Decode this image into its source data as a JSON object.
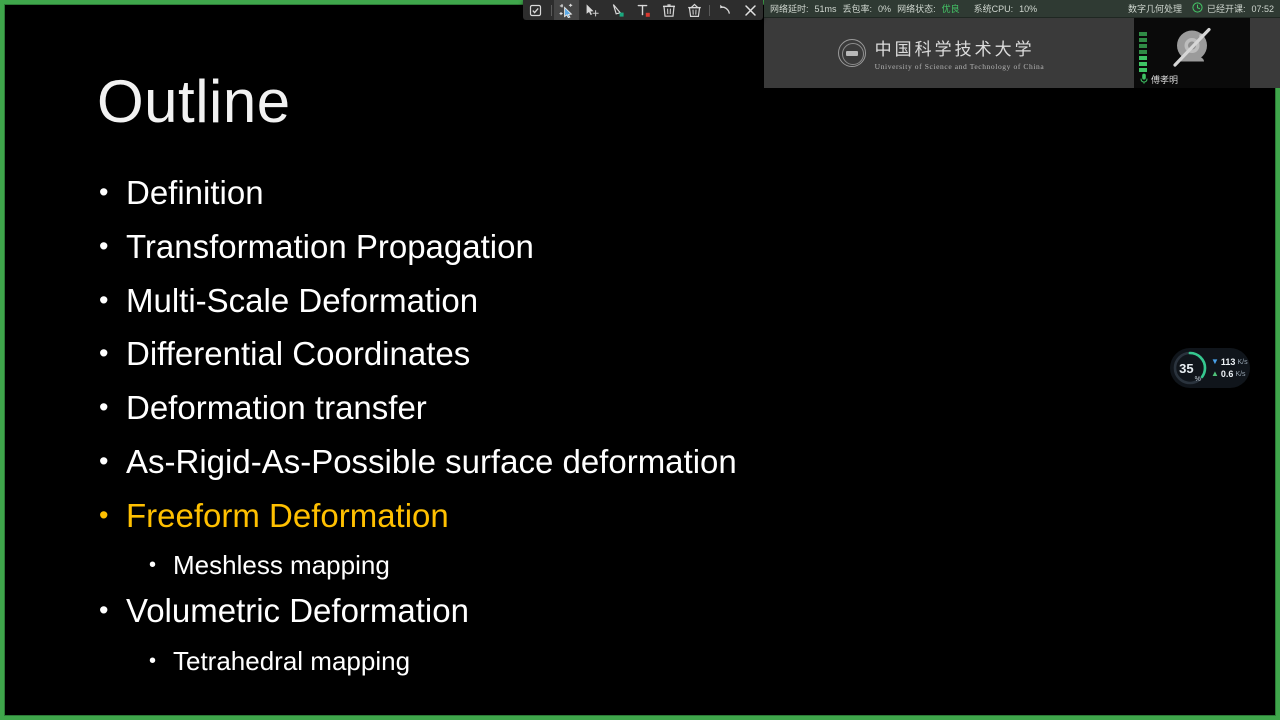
{
  "slide": {
    "title": "Outline",
    "bullet_char": "•",
    "accent_color": "#ffc000",
    "text_color": "#ffffff",
    "background_color": "#000000",
    "items": [
      {
        "level": 1,
        "text": "Definition",
        "highlight": false
      },
      {
        "level": 1,
        "text": "Transformation Propagation",
        "highlight": false
      },
      {
        "level": 1,
        "text": "Multi-Scale Deformation",
        "highlight": false
      },
      {
        "level": 1,
        "text": "Differential Coordinates",
        "highlight": false
      },
      {
        "level": 1,
        "text": "Deformation transfer",
        "highlight": false
      },
      {
        "level": 1,
        "text": "As-Rigid-As-Possible surface deformation",
        "highlight": false
      },
      {
        "level": 1,
        "text": "Freeform Deformation",
        "highlight": true
      },
      {
        "level": 2,
        "text": "Meshless mapping",
        "highlight": false
      },
      {
        "level": 1,
        "text": "Volumetric Deformation",
        "highlight": false
      },
      {
        "level": 2,
        "text": "Tetrahedral mapping",
        "highlight": false
      }
    ]
  },
  "share_border": {
    "color": "#3fa64b"
  },
  "toolbar": {
    "buttons": [
      {
        "name": "checkbox-select-icon",
        "icon": "checkbox",
        "active": false
      },
      {
        "name": "sparkle-cursor-icon",
        "icon": "sparkle",
        "active": true
      },
      {
        "name": "move-pointer-icon",
        "icon": "pointer",
        "active": false
      },
      {
        "name": "pen-tool-icon",
        "icon": "pen",
        "active": false
      },
      {
        "name": "text-tool-icon",
        "icon": "text",
        "active": false
      },
      {
        "name": "delete-icon",
        "icon": "trash",
        "active": false
      },
      {
        "name": "clear-all-icon",
        "icon": "trash-all",
        "active": false
      },
      {
        "name": "undo-icon",
        "icon": "undo",
        "active": false
      },
      {
        "name": "close-icon",
        "icon": "close",
        "active": false
      }
    ]
  },
  "netbar": {
    "latency_label": "网络延时:",
    "latency_value": "51ms",
    "loss_label": "丢包率:",
    "loss_value": "0%",
    "status_label": "网络状态:",
    "status_value": "优良",
    "cpu_label": "系统CPU:",
    "cpu_value": "10%",
    "course_name": "数字几何处理",
    "elapsed_label": "已经开课:",
    "elapsed_value": "07:52",
    "good_color": "#44c767"
  },
  "video_panel": {
    "banner_cn": "中国科学技术大学",
    "banner_en": "University of Science and Technology of China",
    "camera_state": "camera-off",
    "participant_name": "傅孝明",
    "mic_state": "mic-on"
  },
  "speed_widget": {
    "percent": "35",
    "percent_unit": "%",
    "download_value": "113",
    "download_unit": "K/s",
    "download_arrow": "▼",
    "upload_value": "0.6",
    "upload_unit": "K/s",
    "upload_arrow": "▲"
  }
}
